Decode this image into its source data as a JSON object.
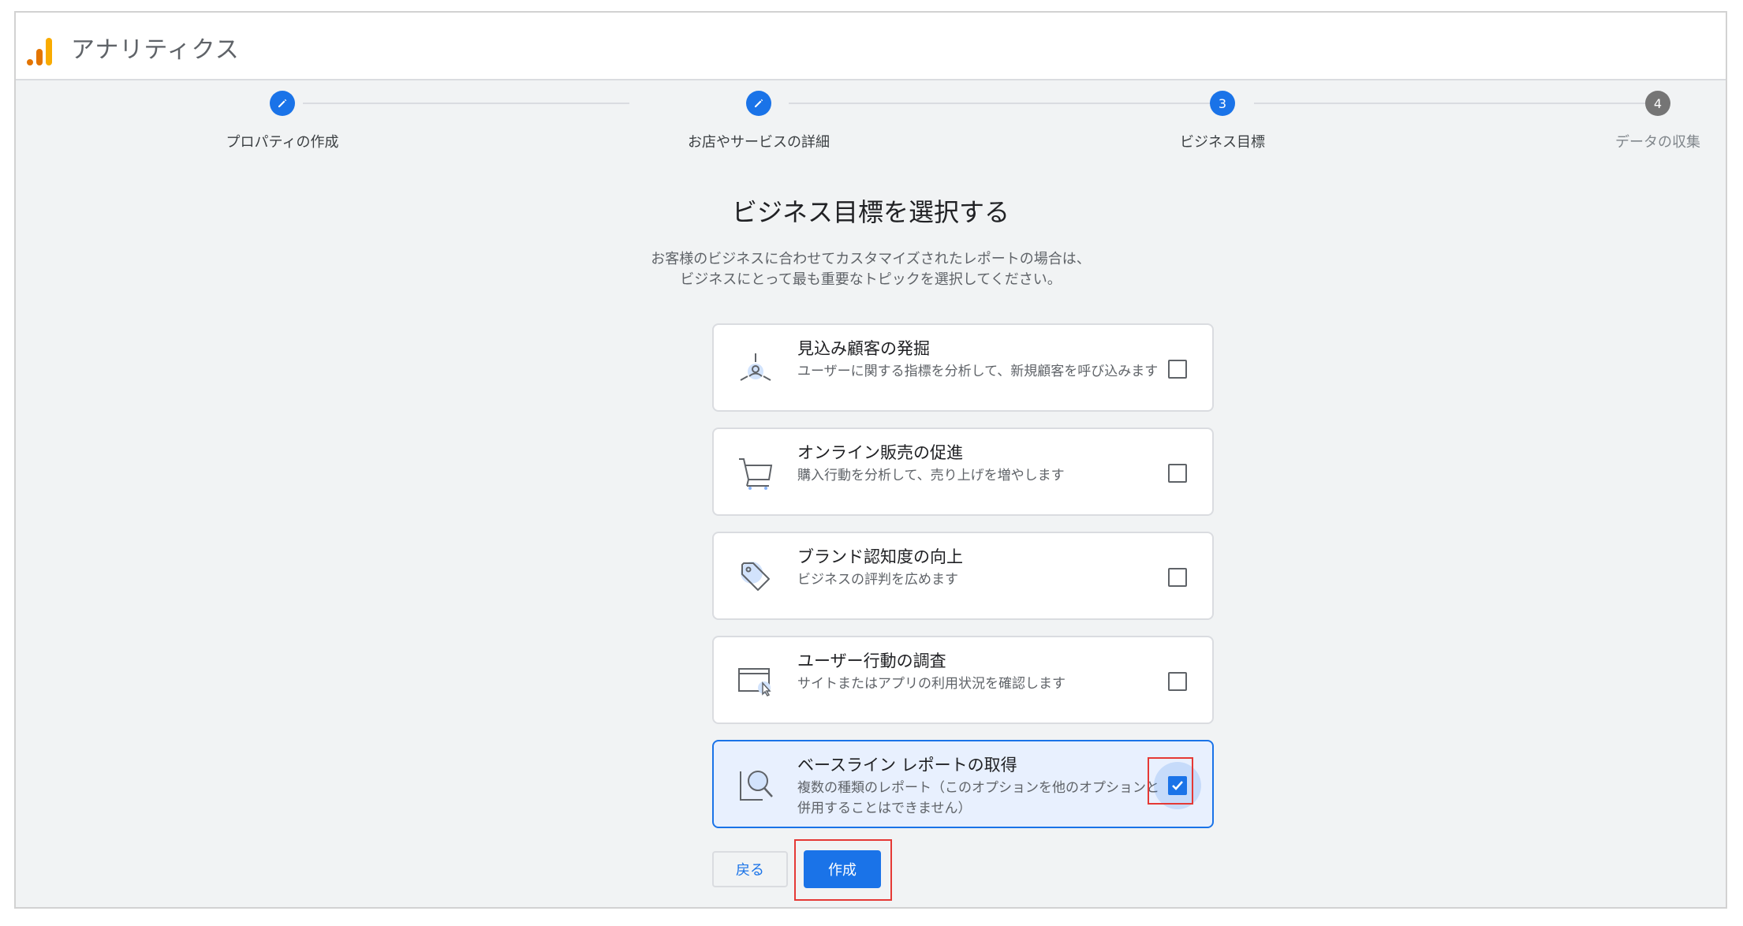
{
  "app": {
    "title": "アナリティクス",
    "logo_icon": "analytics-logo-icon"
  },
  "colors": {
    "accent": "#1a73e8",
    "selected_bg": "#e8f0fe",
    "highlight": "#e53935",
    "logo": "#f9ab00"
  },
  "stepper": {
    "steps": [
      {
        "label": "プロパティの作成",
        "marker": "edit-icon",
        "state": "done"
      },
      {
        "label": "お店やサービスの詳細",
        "marker": "edit-icon",
        "state": "done"
      },
      {
        "label": "ビジネス目標",
        "marker": "3",
        "state": "current"
      },
      {
        "label": "データの収集",
        "marker": "4",
        "state": "upcoming"
      }
    ]
  },
  "main": {
    "title": "ビジネス目標を選択する",
    "description_line1": "お客様のビジネスに合わせてカスタマイズされたレポートの場合は、",
    "description_line2": "ビジネスにとって最も重要なトピックを選択してください。",
    "goals": [
      {
        "title": "見込み顧客の発掘",
        "desc": "ユーザーに関する指標を分析して、新規顧客を呼び込みます",
        "icon": "lead-generation-icon",
        "checked": false
      },
      {
        "title": "オンライン販売の促進",
        "desc": "購入行動を分析して、売り上げを増やします",
        "icon": "shopping-cart-icon",
        "checked": false
      },
      {
        "title": "ブランド認知度の向上",
        "desc": "ビジネスの評判を広めます",
        "icon": "tag-icon",
        "checked": false
      },
      {
        "title": "ユーザー行動の調査",
        "desc": "サイトまたはアプリの利用状況を確認します",
        "icon": "browser-cursor-icon",
        "checked": false
      },
      {
        "title": "ベースライン レポートの取得",
        "desc": "複数の種類のレポート（このオプションを他のオプションと併用することはできません）",
        "icon": "magnify-report-icon",
        "checked": true
      }
    ]
  },
  "actions": {
    "back_label": "戻る",
    "create_label": "作成"
  }
}
